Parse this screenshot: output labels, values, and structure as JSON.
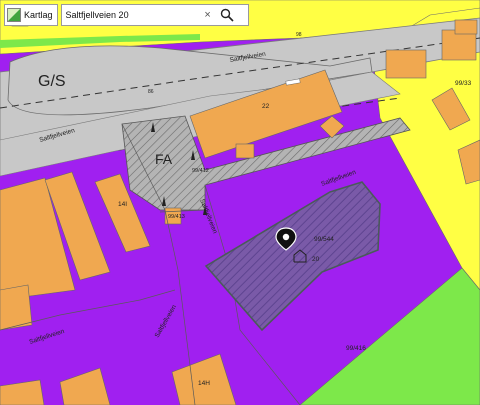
{
  "toolbar": {
    "layers_label": "Kartlag",
    "search_value": "Saltfjellveien 20",
    "clear_symbol": "×",
    "icons": {
      "layers": "layers-icon",
      "search": "search-icon",
      "clear": "close-icon",
      "pin": "map-pin-icon",
      "house": "house-icon"
    }
  },
  "map": {
    "zone_labels": {
      "gs": "G/S",
      "fa": "FA"
    },
    "road_labels": [
      "Saltfjellveien",
      "Saltfjellveien",
      "Saltfjellveien",
      "Saltfjellveien",
      "Saltfjellveien",
      "Saltfjellveien"
    ],
    "parcel_labels": [
      "99/33",
      "99/544",
      "99/416",
      "99/412",
      "99/413"
    ],
    "address_numbers": [
      "22",
      "14I",
      "20",
      "14H",
      "86",
      "98"
    ],
    "colors": {
      "residential": "#ffff44",
      "business": "#a020f0",
      "building": "#f0a850",
      "road": "#c8c8c8",
      "green": "#7de84a",
      "hatch": "#7a5aa8"
    }
  }
}
